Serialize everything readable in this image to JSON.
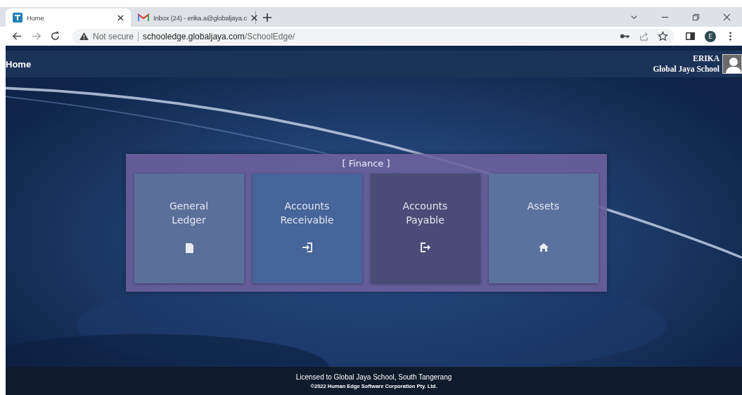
{
  "browser": {
    "tabs": [
      {
        "title": "Home",
        "selected": true
      },
      {
        "title": "Inbox (24) - erika.a@globaljaya.c",
        "selected": false
      }
    ],
    "security": "Not secure",
    "url_host": "schooledge.globaljaya.com",
    "url_path": "/SchoolEdge/",
    "profile": "E"
  },
  "header": {
    "title": "Home",
    "user": "ERIKA",
    "school": "Global Jaya School"
  },
  "panel": {
    "title": "[ Finance ]",
    "tiles": [
      {
        "label": "General\nLedger",
        "color": "#5b6f9b"
      },
      {
        "label": "Accounts\nReceivable",
        "color": "#46659b"
      },
      {
        "label": "Accounts\nPayable",
        "color": "#4b4b77"
      },
      {
        "label": "Assets",
        "color": "#5b729e"
      }
    ]
  },
  "footer": {
    "license": "Licensed to Global Jaya School, South Tangerang",
    "copyright": "©2022 Human Edge Software Corporation Pty. Ltd."
  }
}
